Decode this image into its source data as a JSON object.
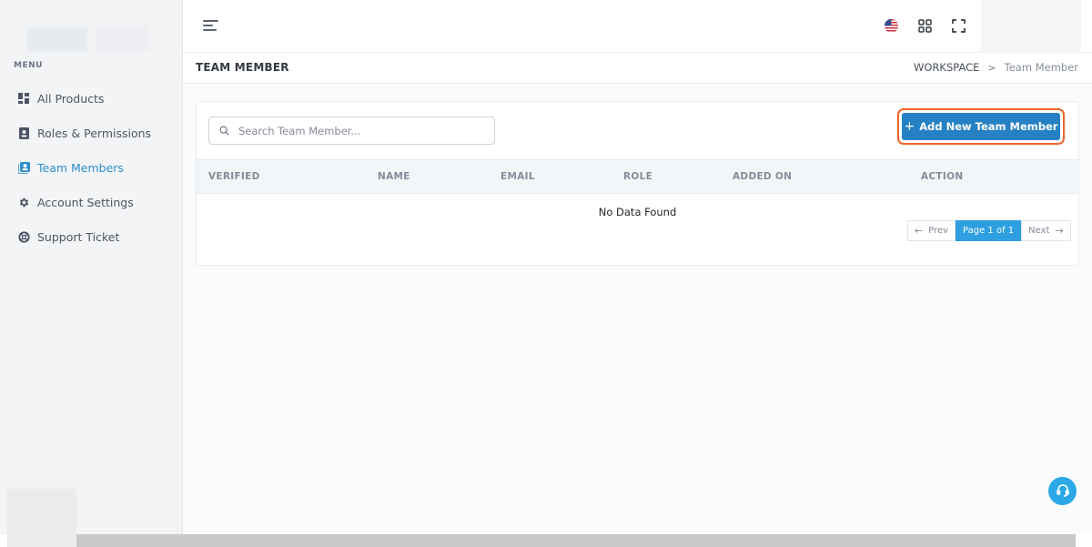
{
  "sidebar": {
    "menu_title": "MENU",
    "items": [
      {
        "label": "All Products",
        "icon": "grid-icon"
      },
      {
        "label": "Roles & Permissions",
        "icon": "id-badge-icon"
      },
      {
        "label": "Team Members",
        "icon": "contact-card-icon",
        "active": true
      },
      {
        "label": "Account Settings",
        "icon": "gear-icon"
      },
      {
        "label": "Support Ticket",
        "icon": "lifebuoy-icon"
      }
    ]
  },
  "topbar": {
    "icons": [
      "menu-toggle-icon",
      "us-flag-icon",
      "apps-grid-icon",
      "fullscreen-icon"
    ]
  },
  "page_header": {
    "title": "TEAM MEMBER",
    "breadcrumb": {
      "parent": "WORKSPACE",
      "separator": ">",
      "current": "Team Member"
    }
  },
  "search": {
    "placeholder": "Search Team Member..."
  },
  "add_button": {
    "label": "Add New Team Member",
    "plus": "+"
  },
  "table": {
    "columns": [
      "VERIFIED",
      "NAME",
      "EMAIL",
      "ROLE",
      "ADDED ON",
      "ACTION"
    ],
    "empty_text": "No Data Found"
  },
  "pagination": {
    "prev_label": "Prev",
    "prev_arrow": "←",
    "page_label": "Page 1 of 1",
    "next_label": "Next",
    "next_arrow": "→"
  },
  "colors": {
    "accent": "#2581c4",
    "active_nav": "#2e8fcb",
    "highlight_border": "#f06529",
    "pager_current": "#2e9fe0",
    "support_button": "#2ba8e8"
  }
}
